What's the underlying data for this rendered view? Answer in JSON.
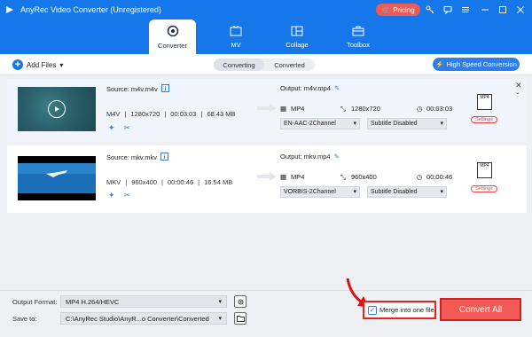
{
  "app": {
    "title": "AnyRec Video Converter (Unregistered)",
    "pricing_label": "Pricing"
  },
  "tabs": [
    {
      "label": "Converter",
      "active": true
    },
    {
      "label": "MV"
    },
    {
      "label": "Collage"
    },
    {
      "label": "Toolbox"
    }
  ],
  "toolbar": {
    "add_files_label": "Add Files",
    "seg_converting": "Converting",
    "seg_converted": "Converted",
    "high_speed_label": "High Speed Conversion"
  },
  "files": [
    {
      "source": "Source: m4v.m4v",
      "format": "M4V",
      "resolution": "1280x720",
      "duration": "00:03:03",
      "size": "68.43 MB",
      "output_name": "Output: m4v.mp4",
      "out_format": "MP4",
      "out_resolution": "1280x720",
      "out_duration": "00:03:03",
      "audio_track": "EN-AAC-2Channel",
      "subtitle": "Subtitle Disabled",
      "settings_label": "Settings",
      "format_badge": "MP4"
    },
    {
      "source": "Source: mkv.mkv",
      "format": "MKV",
      "resolution": "960x400",
      "duration": "00:00:46",
      "size": "16.54 MB",
      "output_name": "Output: mkv.mp4",
      "out_format": "MP4",
      "out_resolution": "960x400",
      "out_duration": "00:00:46",
      "audio_track": "VORBIS-2Channel",
      "subtitle": "Subtitle Disabled",
      "settings_label": "Settings",
      "format_badge": "MP4"
    }
  ],
  "bottom": {
    "output_format_label": "Output Format:",
    "output_format_value": "MP4 H.264/HEVC",
    "save_to_label": "Save to:",
    "save_to_value": "C:\\AnyRec Studio\\AnyR...o Converter\\Converted",
    "merge_label": "Merge into one file",
    "merge_checked": true,
    "convert_all_label": "Convert All"
  },
  "colors": {
    "accent": "#1677ea",
    "danger": "#f25b55",
    "highlight": "#e82020"
  }
}
